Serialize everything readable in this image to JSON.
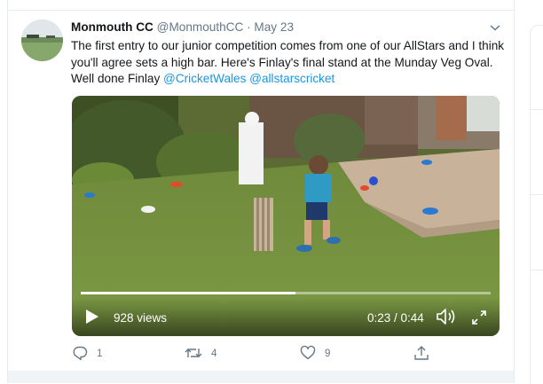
{
  "tweet": {
    "author_name": "Monmouth CC",
    "author_handle": "@MonmouthCC",
    "separator": "·",
    "date": "May 23",
    "text_main": "The first entry to our junior competition comes from one of our AllStars and I think you'll agree sets a high bar. Here's Finlay's final stand at the Munday Veg Oval. Well done Finlay ",
    "mention_1": "@CricketWales",
    "mention_2": "@allstarscricket"
  },
  "video": {
    "views": "928 views",
    "time": "0:23 / 0:44",
    "progress_fraction": 0.523
  },
  "actions": {
    "reply_count": "1",
    "retweet_count": "4",
    "like_count": "9"
  },
  "colors": {
    "link": "#1b95e0",
    "muted": "#657786",
    "border": "#e6ecf0"
  },
  "icons": [
    "caret-down-icon",
    "play-icon",
    "volume-icon",
    "fullscreen-icon",
    "reply-icon",
    "retweet-icon",
    "like-icon",
    "share-icon"
  ]
}
